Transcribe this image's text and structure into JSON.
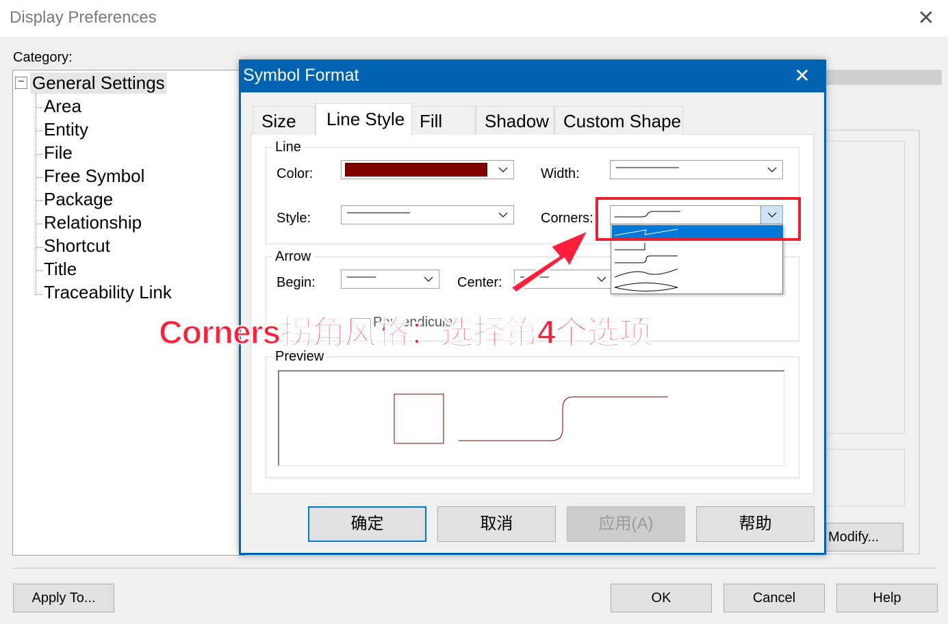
{
  "outer_window": {
    "title": "Display Preferences",
    "close_glyph": "✕",
    "category_label": "Category:",
    "tree": {
      "toggle_glyph": "−",
      "root": "General Settings",
      "children": [
        "Area",
        "Entity",
        "File",
        "Free Symbol",
        "Package",
        "Relationship",
        "Shortcut",
        "Title",
        "Traceability Link"
      ]
    },
    "buttons": {
      "modify": "Modify...",
      "apply_to": "Apply To...",
      "ok": "OK",
      "cancel": "Cancel",
      "help": "Help"
    }
  },
  "dialog": {
    "title": "Symbol Format",
    "close_glyph": "✕",
    "tabs": [
      {
        "label": "Size",
        "active": false
      },
      {
        "label": "Line Style",
        "active": true
      },
      {
        "label": "Fill",
        "active": false
      },
      {
        "label": "Shadow",
        "active": false
      },
      {
        "label": "Custom Shape",
        "active": false
      }
    ],
    "line_group": {
      "label": "Line",
      "color_label": "Color:",
      "color_value": "#800000",
      "width_label": "Width:",
      "style_label": "Style:",
      "corners_label": "Corners:"
    },
    "arrow_group": {
      "label": "Arrow",
      "begin_label": "Begin:",
      "center_label": "Center:",
      "obscured_text": "Perpendicular"
    },
    "preview_group": {
      "label": "Preview"
    },
    "corners_dropdown": {
      "selected_index": 0,
      "options": [
        "straight-corner-icon",
        "square-step-icon",
        "rounded-step-icon",
        "curved-corner-icon",
        "double-curve-icon"
      ]
    },
    "buttons": {
      "confirm": "确定",
      "cancel": "取消",
      "apply": "应用(A)",
      "help": "帮助"
    }
  },
  "annotation": {
    "text": "Corners拐角风格：选择第4个选项"
  },
  "colors": {
    "accent": "#0063b1",
    "selection": "#0078d7",
    "line_color": "#800000",
    "annotation_red": "#ff1f3a",
    "highlight_red": "#e8212f"
  }
}
